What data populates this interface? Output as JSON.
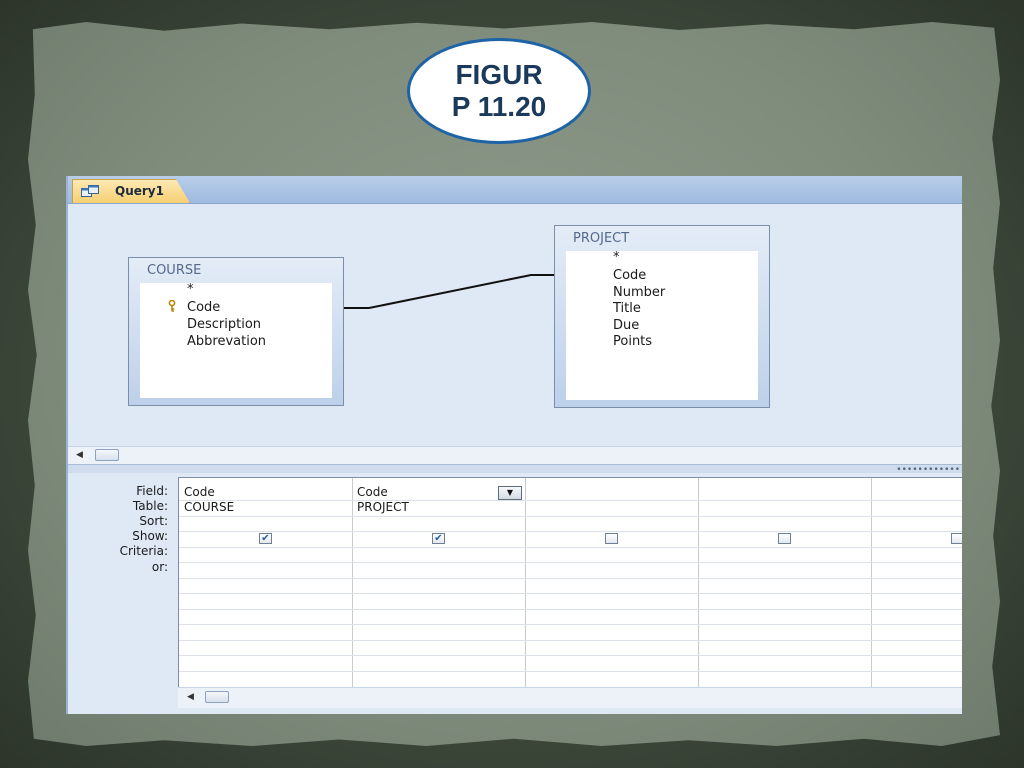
{
  "slide": {
    "title_line1": "FIGUR",
    "title_line2": "P 11.20"
  },
  "window": {
    "tab_label": "Query1"
  },
  "tables": {
    "course": {
      "title": "COURSE",
      "fields": [
        "*",
        "Code",
        "Description",
        "Abbrevation"
      ]
    },
    "project": {
      "title": "PROJECT",
      "fields": [
        "*",
        "Code",
        "Number",
        "Title",
        "Due",
        "Points"
      ]
    }
  },
  "grid": {
    "row_labels": [
      "Field:",
      "Table:",
      "Sort:",
      "Show:",
      "Criteria:",
      "or:"
    ],
    "columns": [
      {
        "field": "Code",
        "table": "COURSE",
        "show": true
      },
      {
        "field": "Code",
        "table": "PROJECT",
        "show": true
      },
      {
        "field": "",
        "table": "",
        "show": false
      },
      {
        "field": "",
        "table": "",
        "show": false
      },
      {
        "field": "",
        "table": "",
        "show": false
      }
    ]
  },
  "colors": {
    "accent_tab": "#f6cf72",
    "oval_border": "#1e63a6"
  }
}
